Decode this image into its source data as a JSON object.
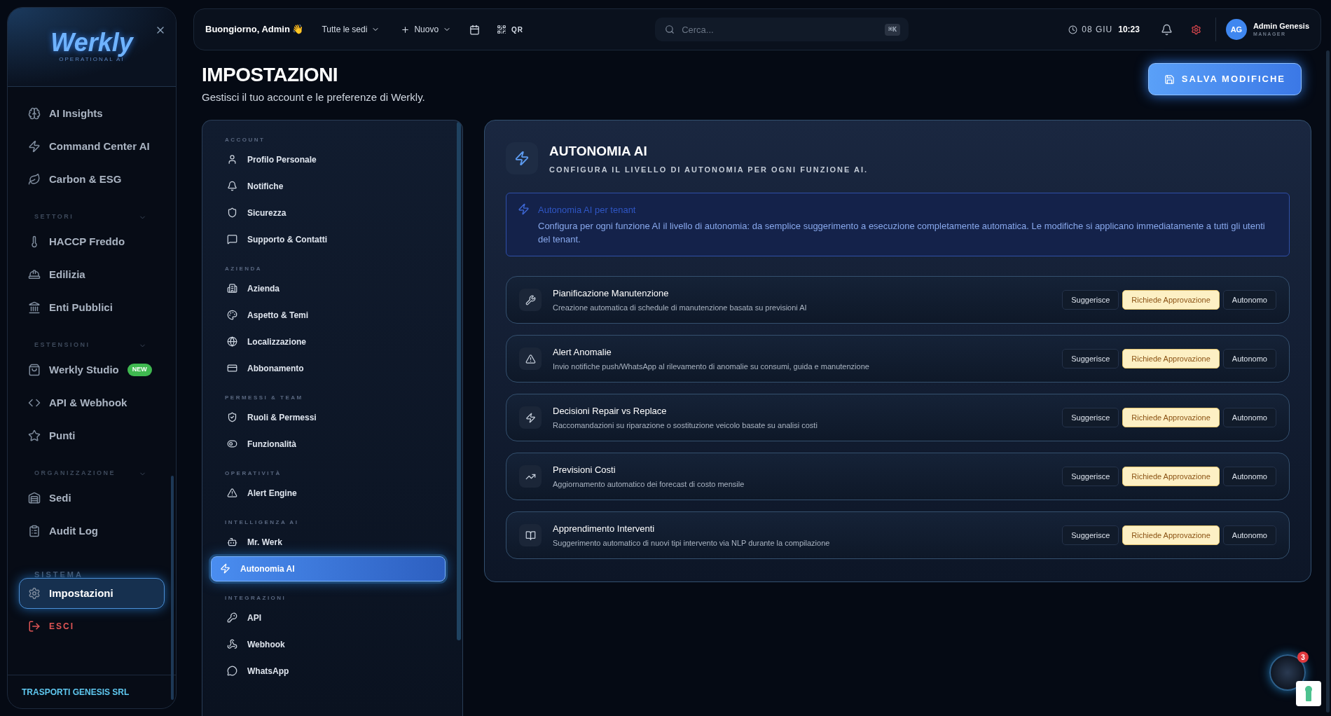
{
  "logo": {
    "name": "Werkly",
    "tagline": "OPERATIONAL AI"
  },
  "sidebar": {
    "sections": [
      {
        "items": [
          {
            "label": "AI Insights",
            "selected": false
          },
          {
            "label": "Command Center AI",
            "selected": false
          },
          {
            "label": "Carbon & ESG",
            "selected": false
          }
        ]
      },
      {
        "title": "SETTORI",
        "expanded": true,
        "items": [
          {
            "label": "HACCP Freddo",
            "selected": false
          },
          {
            "label": "Edilizia",
            "selected": false
          },
          {
            "label": "Enti Pubblici",
            "selected": false
          }
        ]
      },
      {
        "title": "ESTENSIONI",
        "expanded": true,
        "items": [
          {
            "label": "Werkly Studio",
            "selected": false,
            "badge": "NEW"
          },
          {
            "label": "API & Webhook",
            "selected": false
          },
          {
            "label": "Punti",
            "selected": false
          }
        ]
      },
      {
        "title": "ORGANIZZAZIONE",
        "expanded": true,
        "items": [
          {
            "label": "Sedi",
            "selected": false
          },
          {
            "label": "Audit Log",
            "selected": false
          }
        ]
      },
      {
        "title": "SISTEMA",
        "items": [
          {
            "label": "Impostazioni",
            "selected": true
          },
          {
            "label": "ESCI",
            "selected": false,
            "kind": "logout"
          }
        ]
      }
    ],
    "footer": "TRASPORTI GENESIS SRL"
  },
  "topbar": {
    "greeting": "Buongiorno, Admin 👋",
    "location": "Tutte le sedi",
    "new": "Nuovo",
    "qr": "QR",
    "search": {
      "placeholder": "Cerca...",
      "shortcut": "⌘K"
    },
    "date": "08 GIU",
    "time": "10:23",
    "user": {
      "initials": "AG",
      "name": "Admin Genesis",
      "role": "MANAGER"
    }
  },
  "page": {
    "title": "IMPOSTAZIONI",
    "subtitle": "Gestisci il tuo account e le preferenze di Werkly.",
    "save": "SALVA MODIFICHE"
  },
  "settings_nav": [
    {
      "title": "ACCOUNT",
      "items": [
        {
          "label": "Profilo Personale",
          "selected": false
        },
        {
          "label": "Notifiche",
          "selected": false
        },
        {
          "label": "Sicurezza",
          "selected": false
        },
        {
          "label": "Supporto & Contatti",
          "selected": false
        }
      ]
    },
    {
      "title": "AZIENDA",
      "items": [
        {
          "label": "Azienda",
          "selected": false
        },
        {
          "label": "Aspetto & Temi",
          "selected": false
        },
        {
          "label": "Localizzazione",
          "selected": false
        },
        {
          "label": "Abbonamento",
          "selected": false
        }
      ]
    },
    {
      "title": "PERMESSI & TEAM",
      "items": [
        {
          "label": "Ruoli & Permessi",
          "selected": false
        },
        {
          "label": "Funzionalità",
          "selected": false
        }
      ]
    },
    {
      "title": "OPERATIVITÀ",
      "items": [
        {
          "label": "Alert Engine",
          "selected": false
        }
      ]
    },
    {
      "title": "INTELLIGENZA AI",
      "items": [
        {
          "label": "Mr. Werk",
          "selected": false
        },
        {
          "label": "Autonomia AI",
          "selected": true
        }
      ]
    },
    {
      "title": "INTEGRAZIONI",
      "items": [
        {
          "label": "API",
          "selected": false
        },
        {
          "label": "Webhook",
          "selected": false
        },
        {
          "label": "WhatsApp",
          "selected": false
        }
      ]
    }
  ],
  "panel": {
    "title": "AUTONOMIA AI",
    "subtitle": "CONFIGURA IL LIVELLO DI AUTONOMIA PER OGNI FUNZIONE AI.",
    "info": {
      "title": "Autonomia AI per tenant",
      "text": "Configura per ogni funzione AI il livello di autonomia: da semplice suggerimento a esecuzione completamente automatica. Le modifiche si applicano immediatamente a tutti gli utenti del tenant."
    },
    "functions": [
      {
        "name": "Pianificazione Manutenzione",
        "description": "Creazione automatica di schedule di manutenzione basata su previsioni AI",
        "options": [
          {
            "label": "Suggerisce",
            "selected": false
          },
          {
            "label": "Richiede Approvazione",
            "selected": true
          },
          {
            "label": "Autonomo",
            "selected": false
          }
        ]
      },
      {
        "name": "Alert Anomalie",
        "description": "Invio notifiche push/WhatsApp al rilevamento di anomalie su consumi, guida e manutenzione",
        "options": [
          {
            "label": "Suggerisce",
            "selected": false
          },
          {
            "label": "Richiede Approvazione",
            "selected": true
          },
          {
            "label": "Autonomo",
            "selected": false
          }
        ]
      },
      {
        "name": "Decisioni Repair vs Replace",
        "description": "Raccomandazioni su riparazione o sostituzione veicolo basate su analisi costi",
        "options": [
          {
            "label": "Suggerisce",
            "selected": false
          },
          {
            "label": "Richiede Approvazione",
            "selected": true
          },
          {
            "label": "Autonomo",
            "selected": false
          }
        ]
      },
      {
        "name": "Previsioni Costi",
        "description": "Aggiornamento automatico dei forecast di costo mensile",
        "options": [
          {
            "label": "Suggerisce",
            "selected": false
          },
          {
            "label": "Richiede Approvazione",
            "selected": true
          },
          {
            "label": "Autonomo",
            "selected": false
          }
        ]
      },
      {
        "name": "Apprendimento Interventi",
        "description": "Suggerimento automatico di nuovi tipi intervento via NLP durante la compilazione",
        "options": [
          {
            "label": "Suggerisce",
            "selected": false
          },
          {
            "label": "Richiede Approvazione",
            "selected": true
          },
          {
            "label": "Autonomo",
            "selected": false
          }
        ]
      }
    ]
  },
  "assistant": {
    "badge": "3"
  }
}
